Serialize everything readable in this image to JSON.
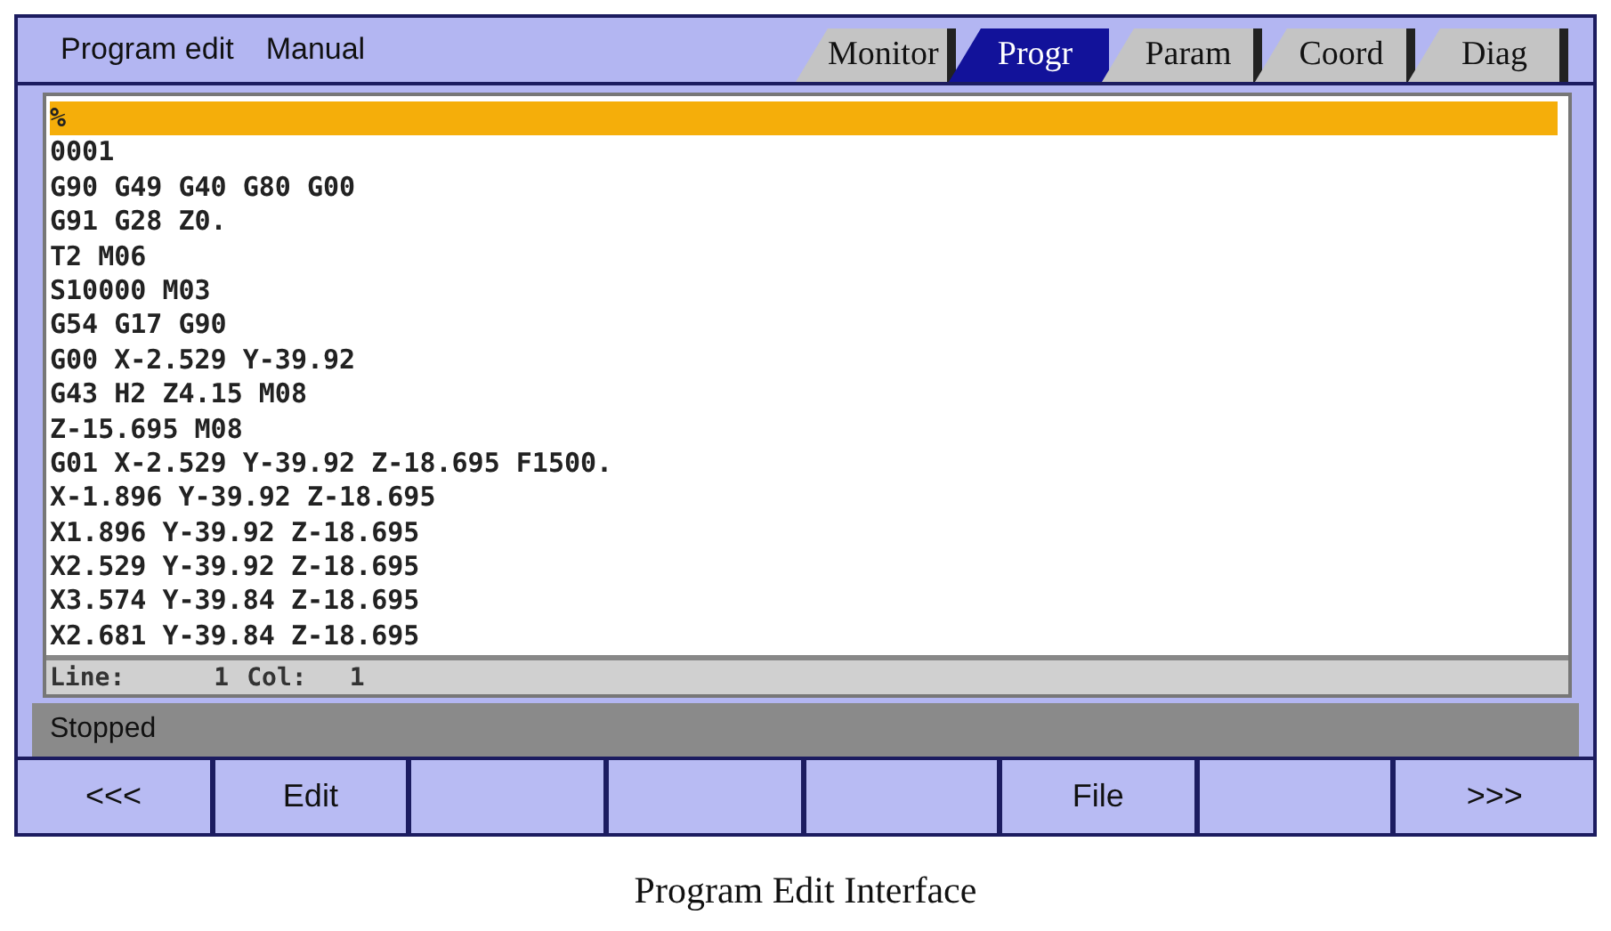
{
  "header": {
    "title": "Program edit",
    "mode": "Manual"
  },
  "tabs": [
    {
      "label": "Monitor",
      "selected": false
    },
    {
      "label": "Progr",
      "selected": true
    },
    {
      "label": "Param",
      "selected": false
    },
    {
      "label": "Coord",
      "selected": false
    },
    {
      "label": "Diag",
      "selected": false
    }
  ],
  "program_lines": [
    {
      "text": "%",
      "selected": true
    },
    {
      "text": "0001",
      "selected": false
    },
    {
      "text": "G90 G49 G40 G80 G00",
      "selected": false
    },
    {
      "text": "G91 G28 Z0.",
      "selected": false
    },
    {
      "text": "T2 M06",
      "selected": false
    },
    {
      "text": "S10000 M03",
      "selected": false
    },
    {
      "text": "G54 G17 G90",
      "selected": false
    },
    {
      "text": "G00 X-2.529 Y-39.92",
      "selected": false
    },
    {
      "text": "G43 H2 Z4.15 M08",
      "selected": false
    },
    {
      "text": "Z-15.695 M08",
      "selected": false
    },
    {
      "text": "G01 X-2.529 Y-39.92 Z-18.695 F1500.",
      "selected": false
    },
    {
      "text": "X-1.896 Y-39.92 Z-18.695",
      "selected": false
    },
    {
      "text": "X1.896 Y-39.92 Z-18.695",
      "selected": false
    },
    {
      "text": "X2.529 Y-39.92 Z-18.695",
      "selected": false
    },
    {
      "text": "X3.574 Y-39.84 Z-18.695",
      "selected": false
    },
    {
      "text": "X2.681 Y-39.84 Z-18.695",
      "selected": false
    }
  ],
  "cursor_status": {
    "line_label": "Line:",
    "line": "1",
    "col_label": "Col:",
    "col": "1"
  },
  "status_bar": "Stopped",
  "softkeys": [
    {
      "kind": "labeled",
      "label": "<<<"
    },
    {
      "kind": "labeled",
      "label": "Edit"
    },
    {
      "kind": "blank"
    },
    {
      "kind": "blank"
    },
    {
      "kind": "blank"
    },
    {
      "kind": "labeled",
      "label": "File"
    },
    {
      "kind": "blank"
    },
    {
      "kind": "labeled",
      "label": ">>>"
    }
  ],
  "caption": "Program Edit Interface"
}
